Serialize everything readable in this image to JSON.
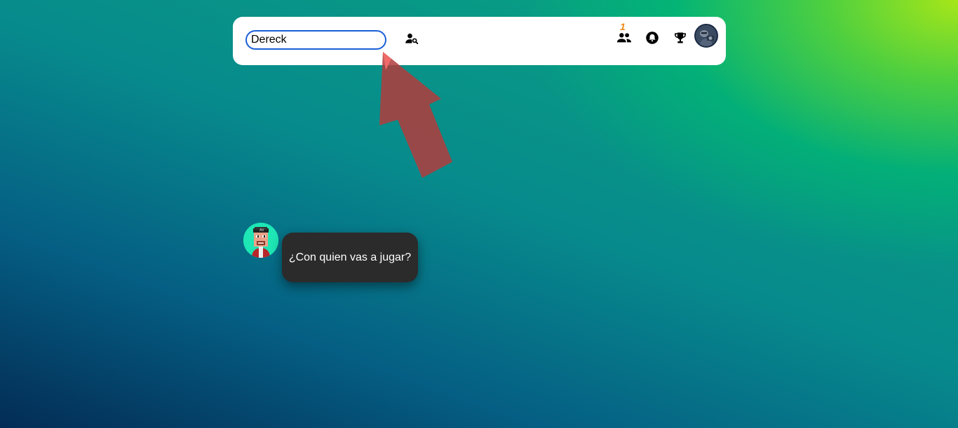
{
  "search": {
    "value": "Dereck",
    "search_user_icon": "person-search-icon"
  },
  "header": {
    "friends_icon": "people-icon",
    "friends_badge": "1",
    "notifications_icon": "bell-icon",
    "trophies_icon": "trophy-icon",
    "profile_avatar": "user-avatar"
  },
  "chat": {
    "bot_avatar": "ape-avatar",
    "message": "¿Con quien vas a jugar?"
  },
  "colors": {
    "arrow": "#b03c3c",
    "input_border": "#1a5fd6",
    "badge": "#ee8a1a",
    "bubble_bg": "#2b2b2b"
  }
}
